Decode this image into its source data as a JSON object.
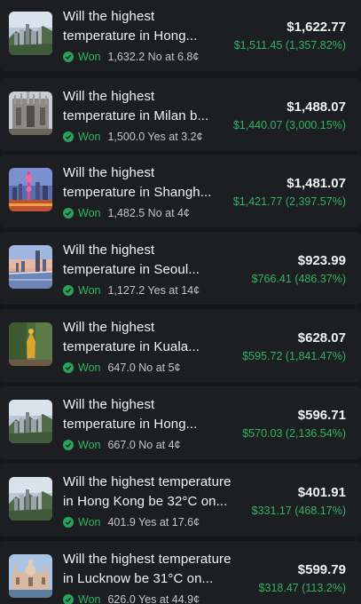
{
  "positions": [
    {
      "title": "Will the highest\ntemperature in Hong...",
      "status": "Won",
      "detail": "1,632.2 No at 6.8¢",
      "value": "$1,622.77",
      "gain": "$1,511.45 (1,357.82%)",
      "image": "hong-kong-skyline"
    },
    {
      "title": "Will the highest\ntemperature in Milan b...",
      "status": "Won",
      "detail": "1,500.0 Yes at 3.2¢",
      "value": "$1,488.07",
      "gain": "$1,440.07 (3,000.15%)",
      "image": "milan-cathedral"
    },
    {
      "title": "Will the highest\ntemperature in Shangh...",
      "status": "Won",
      "detail": "1,482.5 No at 4¢",
      "value": "$1,481.07",
      "gain": "$1,421.77 (2,397.57%)",
      "image": "shanghai-tower"
    },
    {
      "title": "Will the highest\ntemperature in Seoul...",
      "status": "Won",
      "detail": "1,127.2 Yes at 14¢",
      "value": "$923.99",
      "gain": "$766.41 (486.37%)",
      "image": "seoul-river"
    },
    {
      "title": "Will the highest\ntemperature in Kuala...",
      "status": "Won",
      "detail": "647.0 No at 5¢",
      "value": "$628.07",
      "gain": "$595.72 (1,841.47%)",
      "image": "kuala-lumpur-statue"
    },
    {
      "title": "Will the highest\ntemperature in Hong...",
      "status": "Won",
      "detail": "667.0 No at 4¢",
      "value": "$596.71",
      "gain": "$570.03 (2,136.54%)",
      "image": "hong-kong-skyline"
    },
    {
      "title": "Will the highest temperature\nin Hong Kong be 32°C on...",
      "status": "Won",
      "detail": "401.9 Yes at 17.6¢",
      "value": "$401.91",
      "gain": "$331.17 (468.17%)",
      "image": "hong-kong-skyline"
    },
    {
      "title": "Will the highest temperature\nin Lucknow be 31°C on...",
      "status": "Won",
      "detail": "626.0 Yes at 44.9¢",
      "value": "$599.79",
      "gain": "$318.47 (113.2%)",
      "image": "lucknow-palace"
    }
  ],
  "colors": {
    "background": "#16171b",
    "row": "#1d1e22",
    "positive": "#2fb463",
    "text": "#f2f3f5"
  }
}
